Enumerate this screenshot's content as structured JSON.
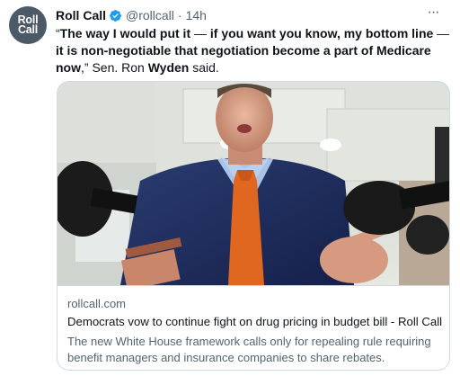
{
  "account": {
    "avatar_line1": "Roll",
    "avatar_line2": "Call",
    "name": "Roll Call",
    "handle": "@rollcall",
    "separator": "·",
    "time": "14h",
    "more_label": "···"
  },
  "tweet": {
    "q_open": "“",
    "part1": "The way I would put it",
    "dash1": " — ",
    "part2": "if you want you know, my bottom line",
    "dash2": " — ",
    "part3": "it is non-negotiable that negotiation become a part of Medicare now",
    "q_close": ",” Sen. Ron ",
    "name": "Wyden",
    "end": " said."
  },
  "card": {
    "domain": "rollcall.com",
    "headline": "Democrats vow to continue fight on drug pricing in budget bill - Roll Call",
    "description": "The new White House framework calls only for repealing rule requiring benefit managers and insurance companies to share rebates."
  },
  "colors": {
    "verified": "#1d9bf0",
    "avatar_bg": "#4b5a66",
    "secondary_text": "#536471",
    "border": "#cfd9de"
  },
  "icons": {
    "verified": "verified-badge-icon",
    "more": "more-options-icon"
  }
}
